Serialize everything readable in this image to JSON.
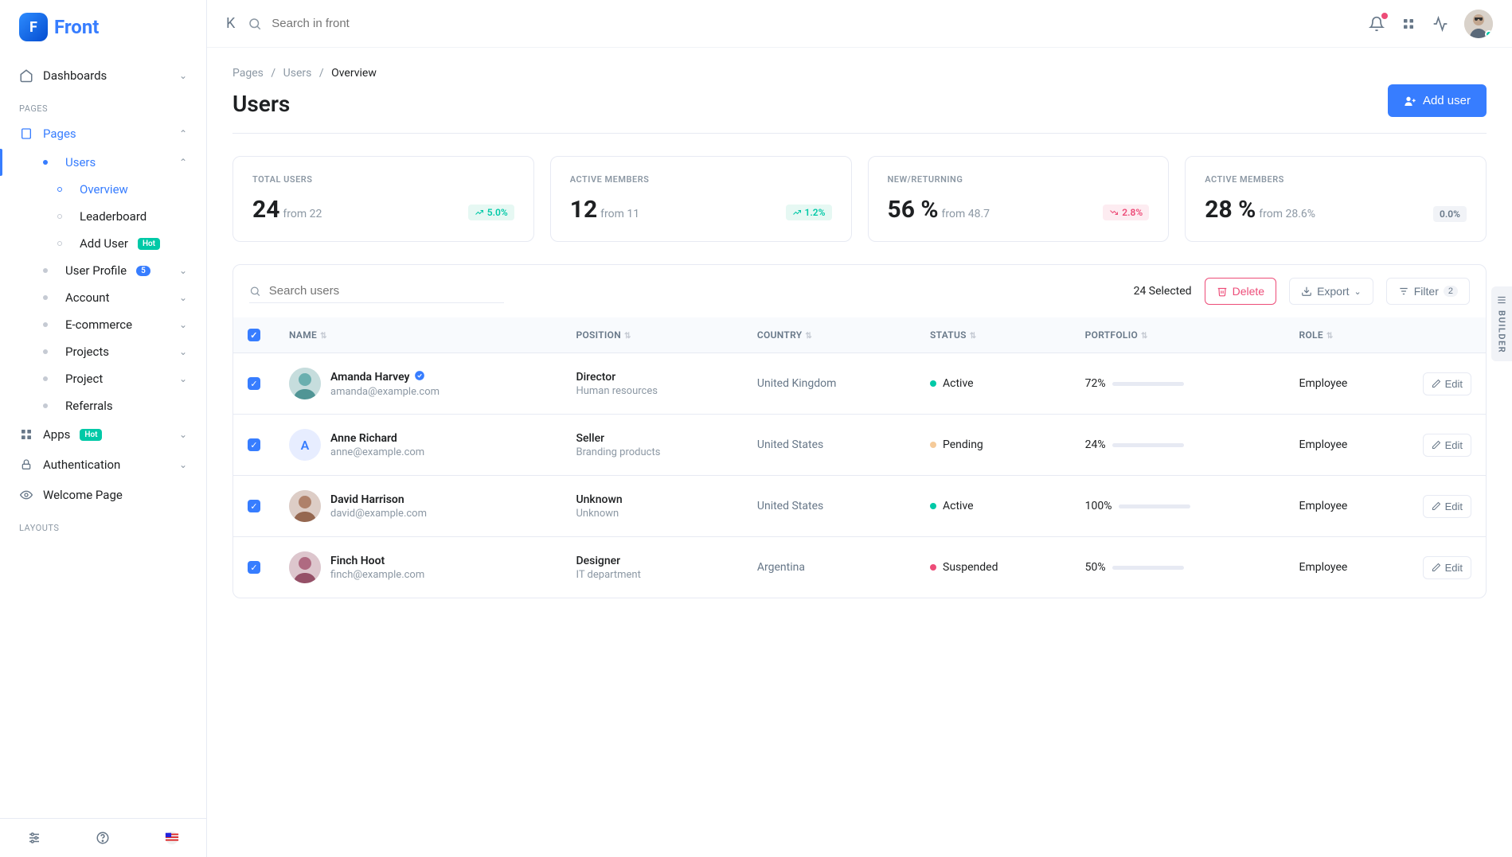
{
  "brand": "Front",
  "sidebar": {
    "dashboards": "Dashboards",
    "sections": {
      "pages": "PAGES",
      "layouts": "LAYOUTS"
    },
    "pages_label": "Pages",
    "users_label": "Users",
    "users_children": {
      "overview": "Overview",
      "leaderboard": "Leaderboard",
      "add_user": "Add User",
      "add_user_badge": "Hot"
    },
    "user_profile": "User Profile",
    "user_profile_count": "5",
    "account": "Account",
    "ecommerce": "E-commerce",
    "projects": "Projects",
    "project": "Project",
    "referrals": "Referrals",
    "apps": "Apps",
    "apps_badge": "Hot",
    "authentication": "Authentication",
    "welcome": "Welcome Page"
  },
  "topbar": {
    "search_placeholder": "Search in front"
  },
  "breadcrumb": {
    "a": "Pages",
    "b": "Users",
    "c": "Overview"
  },
  "page": {
    "title": "Users",
    "add_button": "Add user"
  },
  "cards": [
    {
      "label": "TOTAL USERS",
      "value": "24",
      "from": "from 22",
      "trend": "5.0%",
      "dir": "up"
    },
    {
      "label": "ACTIVE MEMBERS",
      "value": "12",
      "from": "from 11",
      "trend": "1.2%",
      "dir": "up"
    },
    {
      "label": "NEW/RETURNING",
      "value": "56 %",
      "from": "from 48.7",
      "trend": "2.8%",
      "dir": "down"
    },
    {
      "label": "ACTIVE MEMBERS",
      "value": "28 %",
      "from": "from 28.6%",
      "trend": "0.0%",
      "dir": "neutral"
    }
  ],
  "table": {
    "search_placeholder": "Search users",
    "selected_text": "24 Selected",
    "delete": "Delete",
    "export": "Export",
    "filter": "Filter",
    "filter_count": "2",
    "edit": "Edit",
    "headers": {
      "name": "NAME",
      "position": "POSITION",
      "country": "COUNTRY",
      "status": "STATUS",
      "portfolio": "PORTFOLIO",
      "role": "ROLE"
    },
    "rows": [
      {
        "name": "Amanda Harvey",
        "verified": true,
        "email": "amanda@example.com",
        "position": "Director",
        "dept": "Human resources",
        "country": "United Kingdom",
        "status": "Active",
        "status_cls": "active",
        "portfolio": "72%",
        "pct": 72,
        "role": "Employee",
        "avatar": "img",
        "initial": "A",
        "hue": 180
      },
      {
        "name": "Anne Richard",
        "verified": false,
        "email": "anne@example.com",
        "position": "Seller",
        "dept": "Branding products",
        "country": "United States",
        "status": "Pending",
        "status_cls": "pending",
        "portfolio": "24%",
        "pct": 24,
        "role": "Employee",
        "avatar": "letter",
        "initial": "A",
        "hue": 0
      },
      {
        "name": "David Harrison",
        "verified": false,
        "email": "david@example.com",
        "position": "Unknown",
        "dept": "Unknown",
        "country": "United States",
        "status": "Active",
        "status_cls": "active",
        "portfolio": "100%",
        "pct": 100,
        "role": "Employee",
        "avatar": "img",
        "initial": "D",
        "hue": 20
      },
      {
        "name": "Finch Hoot",
        "verified": false,
        "email": "finch@example.com",
        "position": "Designer",
        "dept": "IT department",
        "country": "Argentina",
        "status": "Suspended",
        "status_cls": "suspended",
        "portfolio": "50%",
        "pct": 50,
        "role": "Employee",
        "avatar": "img",
        "initial": "F",
        "hue": 340
      }
    ]
  },
  "builder": "BUILDER"
}
